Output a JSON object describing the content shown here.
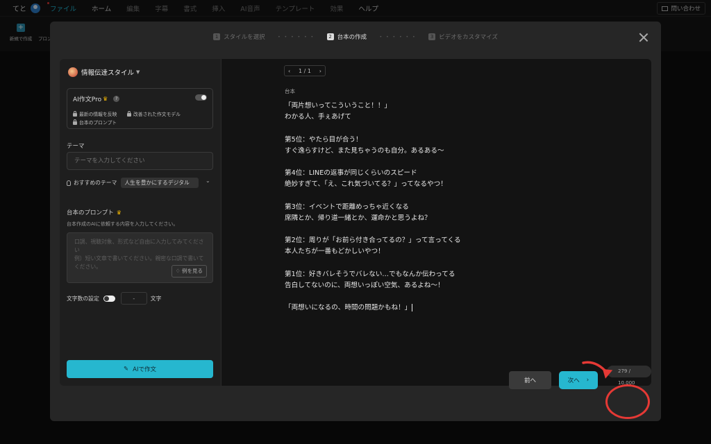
{
  "menubar": {
    "user": "てと",
    "items": [
      "ファイル",
      "ホーム",
      "編集",
      "字幕",
      "書式",
      "挿入",
      "AI音声",
      "テンプレート",
      "効果",
      "ヘルプ"
    ],
    "support": "問い合わせ"
  },
  "toolbar": {
    "new_project": "新規で作成",
    "prompt_partial": "プロン"
  },
  "modal": {
    "steps": [
      {
        "num": "1",
        "label": "スタイルを選択"
      },
      {
        "num": "2",
        "label": "台本の作成"
      },
      {
        "num": "3",
        "label": "ビデオをカスタマイズ"
      }
    ],
    "dots": "・・・・・・"
  },
  "left": {
    "style_name": "情報伝達スタイル",
    "pro_title": "AI作文Pro",
    "pro_help": "?",
    "features": [
      "最新の情報を反映",
      "改善された作文モデル",
      "台本のプロンプト"
    ],
    "theme_label": "テーマ",
    "theme_placeholder": "テーマを入力してください",
    "recommended_label": "おすすめのテーマ",
    "recommended_value": "人生を豊かにするデジタル",
    "prompt_label": "台本のプロンプト",
    "prompt_desc": "台本作成のAIに依頼する内容を入力してください。",
    "prompt_placeholder": "口調、視聴対象、形式など自由に入力してみてください\n例）短い文章で書いてください。親密な口調で書いてください。",
    "example_button": "例を見る",
    "char_setting_label": "文字数の設定",
    "char_value": "-",
    "char_unit": "文字",
    "ai_button": "AIで作文"
  },
  "right": {
    "pager": "1 / 1",
    "script_label": "台本",
    "script_lines": [
      "「両片想いってこういうこと！！」",
      "わかる人、手ぇあげて",
      "",
      "第5位：やたら目が合う！",
      "すぐ逸らすけど、また見ちゃうのも自分。あるある〜",
      "",
      "第4位：LINEの返事が同じくらいのスピード",
      "絶妙すぎて、「え、これ気づいてる？」ってなるやつ！",
      "",
      "第3位：イベントで距離めっちゃ近くなる",
      "席隣とか、帰り道一緒とか、運命かと思うよね？",
      "",
      "第2位：周りが「お前ら付き合ってるの？」って言ってくる",
      "本人たちが一番もどかしいやつ！",
      "",
      "第1位：好きバレそうでバレない…でもなんか伝わってる",
      "告白してないのに、両想いっぽい空気、あるよね〜！",
      "",
      "「両想いになるの、時間の問題かもね！」"
    ],
    "char_count": "279 / 10,000"
  },
  "footer": {
    "prev": "前へ",
    "next": "次へ"
  },
  "colors": {
    "accent": "#26b7cf",
    "annotation": "#e53935"
  }
}
